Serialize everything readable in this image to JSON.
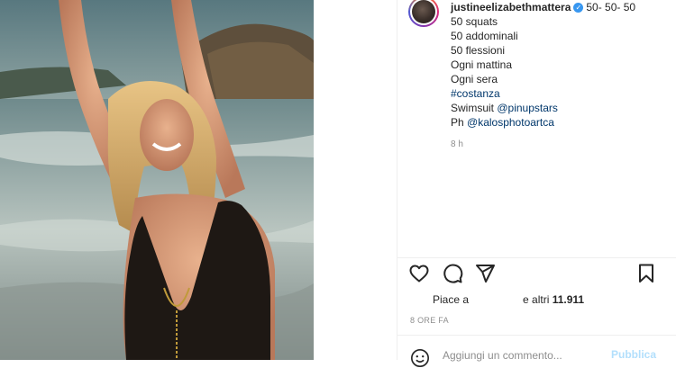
{
  "post": {
    "username": "justineelizabethmattera",
    "verified": true,
    "caption_lines": [
      "50- 50- 50",
      "50 squats",
      "50 addominali",
      "50 flessioni",
      "Ogni mattina",
      "Ogni sera",
      "#costanza",
      "Swimsuit ",
      "@pinupstars",
      "Ph ",
      "@kalosphotoartca"
    ],
    "caption_time": "8 h"
  },
  "icons": {
    "like": "heart-icon",
    "comment": "comment-icon",
    "share": "paper-plane-icon",
    "save": "bookmark-icon",
    "emoji": "emoji-icon",
    "verified": "verified-badge-icon"
  },
  "likes": {
    "prefix": "Piace a",
    "suffix": "e altri",
    "count": "11.911"
  },
  "timestamp": "8 ORE FA",
  "comment": {
    "placeholder": "Aggiungi un commento...",
    "publish_label": "Pubblica"
  },
  "colors": {
    "link": "#00376b",
    "verified": "#3897f0",
    "publish_disabled": "#b2dffc",
    "muted": "#8e8e8e"
  }
}
